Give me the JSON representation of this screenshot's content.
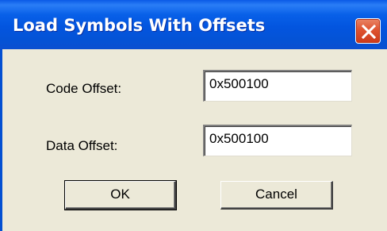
{
  "dialog": {
    "title": "Load Symbols With Offsets",
    "close_icon": "close-icon",
    "accent_color": "#0450d2",
    "close_color": "#de5330"
  },
  "form": {
    "code_offset_label": "Code Offset:",
    "code_offset_value": "0x500100",
    "data_offset_label": "Data Offset:",
    "data_offset_value": "0x500100"
  },
  "buttons": {
    "ok_label": "OK",
    "cancel_label": "Cancel"
  }
}
